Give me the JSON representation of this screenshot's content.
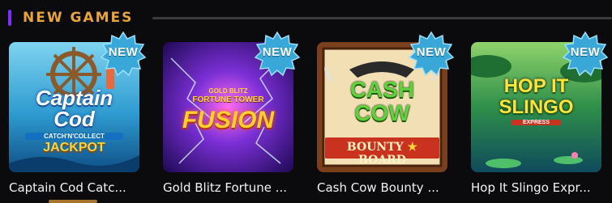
{
  "section": {
    "title": "NEW GAMES"
  },
  "badge_label": "NEW",
  "colors": {
    "accent": "#7b2ff7",
    "title": "#e8a33b",
    "badge": "#39a8d8"
  },
  "games": [
    {
      "title": "Captain Cod Catc...",
      "logo_lines": [
        "Captain",
        "Cod"
      ],
      "sub": "CATCH'N'COLLECT",
      "sub2": "JACKPOT"
    },
    {
      "title": "Gold Blitz Fortune ...",
      "logo_top": "GOLD BLITZ",
      "logo_mid": "FORTUNE TOWER",
      "logo_main": "FUSION"
    },
    {
      "title": "Cash Cow Bounty ...",
      "logo_lines": [
        "CASH",
        "COW"
      ],
      "sub": "BOUNTY",
      "sub2": "BOARD"
    },
    {
      "title": "Hop It Slingo Expr...",
      "logo_lines": [
        "HOP IT",
        "SLINGO"
      ],
      "sub": "EXPRESS"
    }
  ]
}
